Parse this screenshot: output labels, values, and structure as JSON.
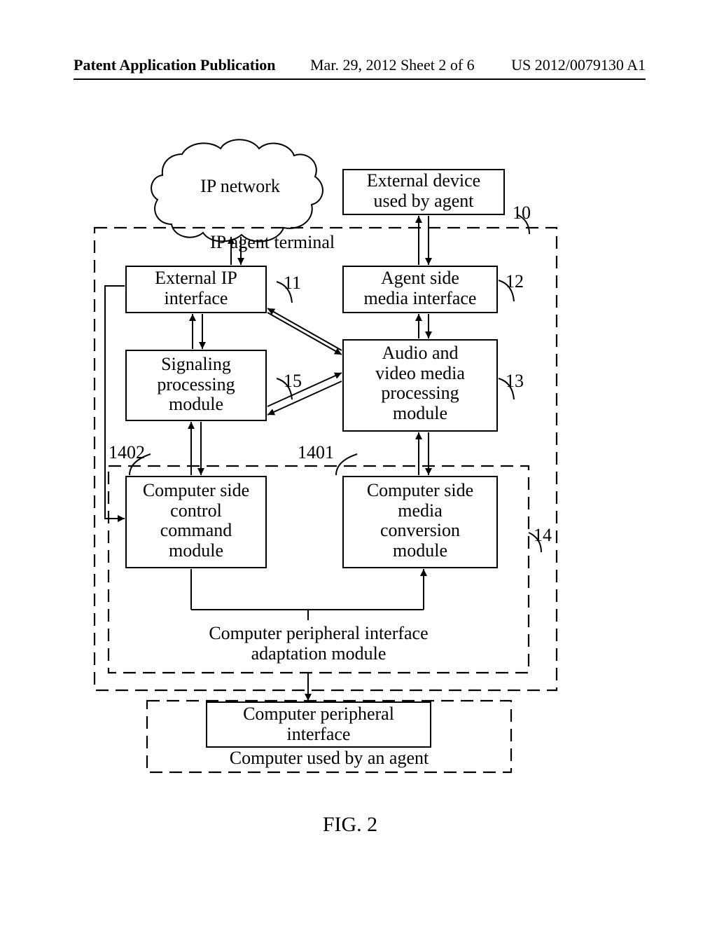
{
  "header": {
    "left": "Patent Application Publication",
    "center": "Mar. 29, 2012  Sheet 2 of 6",
    "right": "US 2012/0079130 A1"
  },
  "diagram": {
    "ip_network": "IP network",
    "external_device": "External device\nused by agent",
    "ip_agent_terminal_label": "IP agent terminal",
    "external_ip_interface": "External IP\ninterface",
    "agent_side_media_interface": "Agent side\nmedia interface",
    "signaling_processing_module": "Signaling\nprocessing\nmodule",
    "audio_video_processing_module": "Audio and\nvideo media\nprocessing\nmodule",
    "computer_side_control_command_module": "Computer side\ncontrol\ncommand\nmodule",
    "computer_side_media_conversion_module": "Computer side\nmedia\nconversion\nmodule",
    "computer_peripheral_interface_adaptation_module": "Computer peripheral interface\nadaptation module",
    "computer_peripheral_interface": "Computer peripheral\ninterface",
    "computer_used_by_agent": "Computer used by an agent",
    "refs": {
      "r10": "10",
      "r11": "11",
      "r12": "12",
      "r13": "13",
      "r14": "14",
      "r15": "15",
      "r1401": "1401",
      "r1402": "1402"
    }
  },
  "figure_label": "FIG. 2"
}
